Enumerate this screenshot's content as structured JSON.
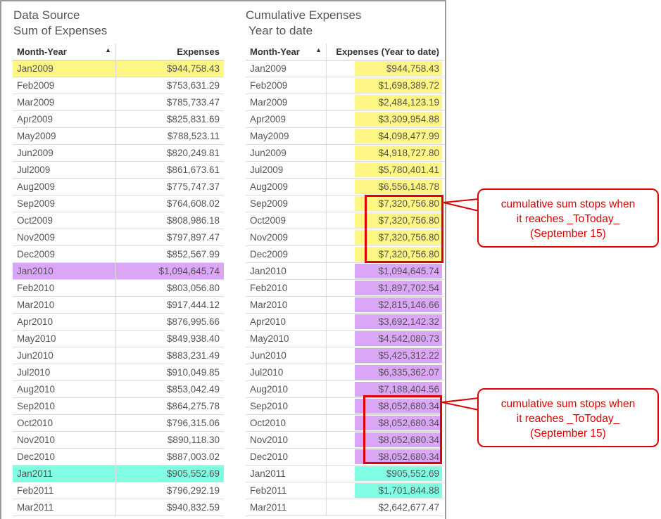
{
  "left": {
    "title1": "Data Source",
    "title2": "Sum of Expenses",
    "headers": [
      "Month-Year",
      "Expenses"
    ],
    "rows": [
      [
        "Jan2009",
        "$944,758.43"
      ],
      [
        "Feb2009",
        "$753,631.29"
      ],
      [
        "Mar2009",
        "$785,733.47"
      ],
      [
        "Apr2009",
        "$825,831.69"
      ],
      [
        "May2009",
        "$788,523.11"
      ],
      [
        "Jun2009",
        "$820,249.81"
      ],
      [
        "Jul2009",
        "$861,673.61"
      ],
      [
        "Aug2009",
        "$775,747.37"
      ],
      [
        "Sep2009",
        "$764,608.02"
      ],
      [
        "Oct2009",
        "$808,986.18"
      ],
      [
        "Nov2009",
        "$797,897.47"
      ],
      [
        "Dec2009",
        "$852,567.99"
      ],
      [
        "Jan2010",
        "$1,094,645.74"
      ],
      [
        "Feb2010",
        "$803,056.80"
      ],
      [
        "Mar2010",
        "$917,444.12"
      ],
      [
        "Apr2010",
        "$876,995.66"
      ],
      [
        "May2010",
        "$849,938.40"
      ],
      [
        "Jun2010",
        "$883,231.49"
      ],
      [
        "Jul2010",
        "$910,049.85"
      ],
      [
        "Aug2010",
        "$853,042.49"
      ],
      [
        "Sep2010",
        "$864,275.78"
      ],
      [
        "Oct2010",
        "$796,315.06"
      ],
      [
        "Nov2010",
        "$890,118.30"
      ],
      [
        "Dec2010",
        "$887,003.02"
      ],
      [
        "Jan2011",
        "$905,552.69"
      ],
      [
        "Feb2011",
        "$796,292.19"
      ],
      [
        "Mar2011",
        "$940,832.59"
      ]
    ]
  },
  "right": {
    "title1": "Cumulative Expenses",
    "title2": "Year to date",
    "headers": [
      "Month-Year",
      "Expenses (Year to date)"
    ],
    "rows": [
      [
        "Jan2009",
        "$944,758.43"
      ],
      [
        "Feb2009",
        "$1,698,389.72"
      ],
      [
        "Mar2009",
        "$2,484,123.19"
      ],
      [
        "Apr2009",
        "$3,309,954.88"
      ],
      [
        "May2009",
        "$4,098,477.99"
      ],
      [
        "Jun2009",
        "$4,918,727.80"
      ],
      [
        "Jul2009",
        "$5,780,401.41"
      ],
      [
        "Aug2009",
        "$6,556,148.78"
      ],
      [
        "Sep2009",
        "$7,320,756.80"
      ],
      [
        "Oct2009",
        "$7,320,756.80"
      ],
      [
        "Nov2009",
        "$7,320,756.80"
      ],
      [
        "Dec2009",
        "$7,320,756.80"
      ],
      [
        "Jan2010",
        "$1,094,645.74"
      ],
      [
        "Feb2010",
        "$1,897,702.54"
      ],
      [
        "Mar2010",
        "$2,815,146.66"
      ],
      [
        "Apr2010",
        "$3,692,142.32"
      ],
      [
        "May2010",
        "$4,542,080.73"
      ],
      [
        "Jun2010",
        "$5,425,312.22"
      ],
      [
        "Jul2010",
        "$6,335,362.07"
      ],
      [
        "Aug2010",
        "$7,188,404.56"
      ],
      [
        "Sep2010",
        "$8,052,680.34"
      ],
      [
        "Oct2010",
        "$8,052,680.34"
      ],
      [
        "Nov2010",
        "$8,052,680.34"
      ],
      [
        "Dec2010",
        "$8,052,680.34"
      ],
      [
        "Jan2011",
        "$905,552.69"
      ],
      [
        "Feb2011",
        "$1,701,844.88"
      ],
      [
        "Mar2011",
        "$2,642,677.47"
      ]
    ]
  },
  "callouts": [
    {
      "line1": "cumulative sum stops when",
      "line2": "it reaches _ToToday_",
      "line3": "(September 15)"
    },
    {
      "line1": "cumulative sum stops when",
      "line2": "it reaches _ToToday_",
      "line3": "(September 15)"
    }
  ],
  "colors": {
    "2009": "#fdf584",
    "2010": "#dba6f6",
    "2011": "#80fde2",
    "annotation": "#e00000"
  }
}
